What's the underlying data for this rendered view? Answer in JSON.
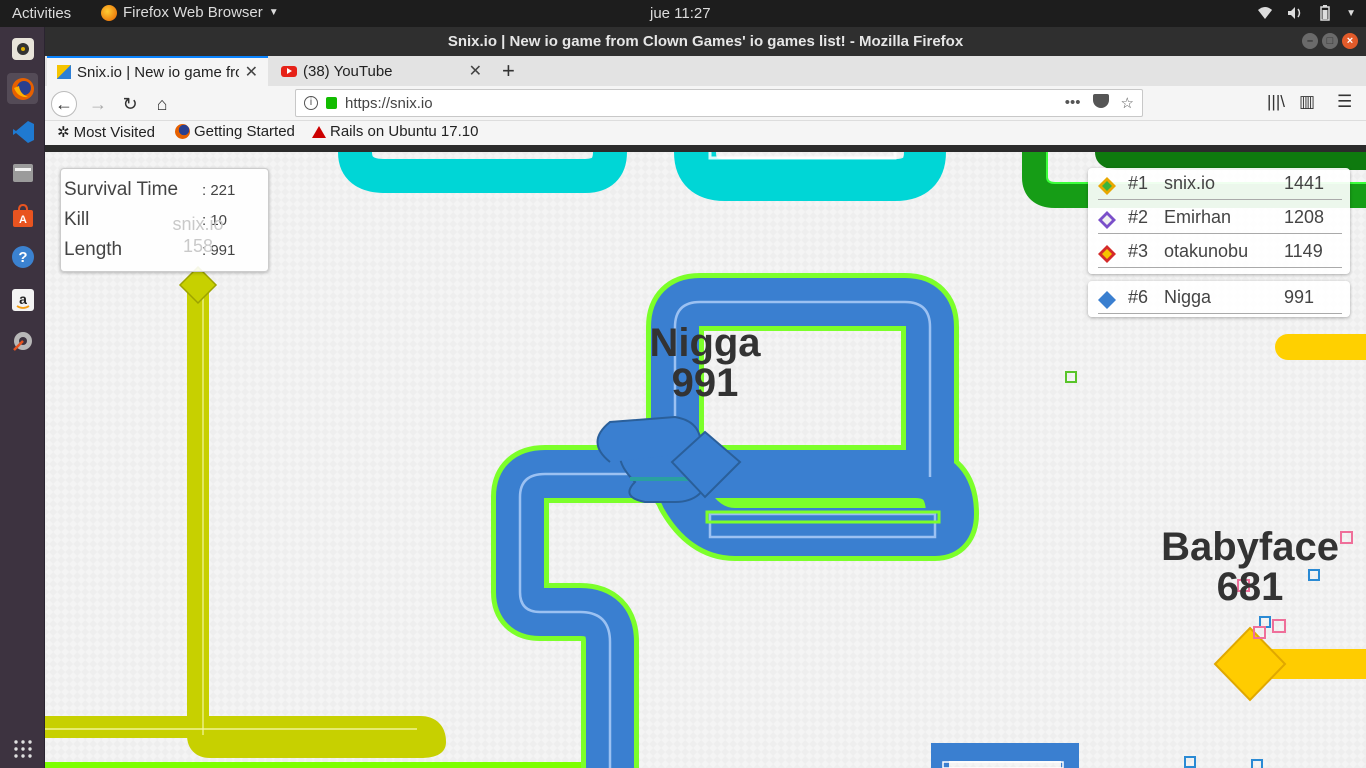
{
  "topbar": {
    "activities": "Activities",
    "app_name": "Firefox Web Browser",
    "clock": "jue 11:27"
  },
  "launcher": {
    "items": [
      "rhythmbox-icon",
      "firefox-icon",
      "vscode-icon",
      "files-icon",
      "software-center-icon",
      "help-icon",
      "amazon-icon",
      "settings-icon",
      "app-grid-icon"
    ]
  },
  "window": {
    "title": "Snix.io | New io game from Clown Games' io games list! - Mozilla Firefox"
  },
  "tabs": [
    {
      "title": "Snix.io | New io game from Clown Games' io games list!",
      "selected": true
    },
    {
      "title": "(38) YouTube",
      "selected": false
    }
  ],
  "navbar": {
    "url": "https://snix.io"
  },
  "bookmarks": [
    {
      "label": "Most Visited",
      "icon": "gear-icon"
    },
    {
      "label": "Getting Started",
      "icon": "firefox-icon"
    },
    {
      "label": "Rails on Ubuntu 17.10",
      "icon": "rails-icon"
    }
  ],
  "game": {
    "stats": {
      "survival_label": "Survival Time",
      "survival_value": ": 221",
      "kill_label": "Kill",
      "kill_value": ": 10",
      "length_label": "Length",
      "length_value": ": 991"
    },
    "ghost_snake": {
      "name": "snix.io",
      "score": "158"
    },
    "leaderboard": [
      {
        "rank": "#1",
        "name": "snix.io",
        "score": "1441",
        "color": "#e8a800"
      },
      {
        "rank": "#2",
        "name": "Emirhan",
        "score": "1208",
        "color": "#7a4fc9"
      },
      {
        "rank": "#3",
        "name": "otakunobu",
        "score": "1149",
        "color": "#d42a2a"
      }
    ],
    "my_rank": {
      "rank": "#6",
      "name": "Nigga",
      "score": "991",
      "color": "#3a7fd0"
    },
    "player": {
      "name": "Nigga",
      "score": "991"
    },
    "other_snake": {
      "name": "Babyface",
      "score": "681"
    }
  }
}
